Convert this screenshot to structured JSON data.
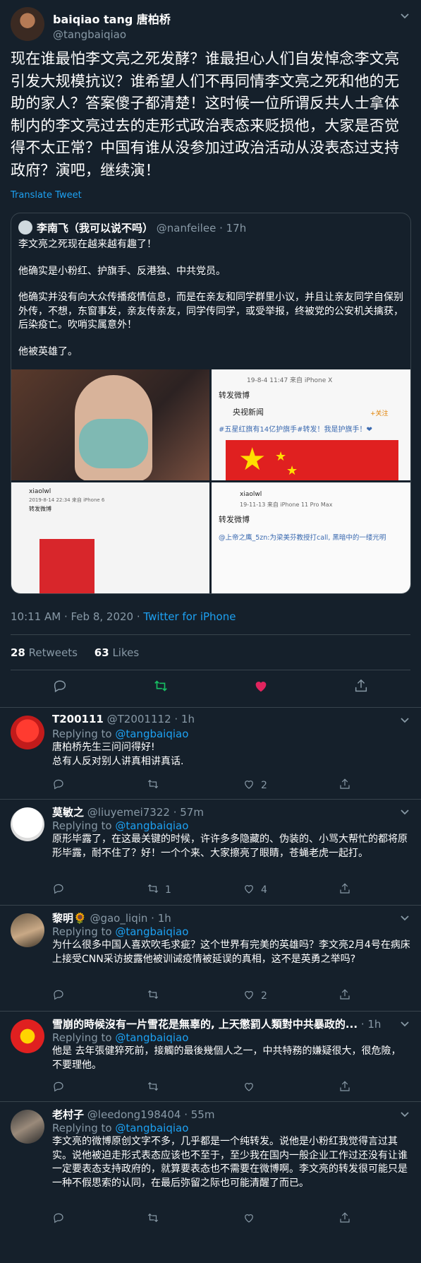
{
  "main_tweet": {
    "display_name": "baiqiao tang 唐柏桥",
    "handle": "@tangbaiqiao",
    "text": "现在谁最怕李文亮之死发酵？谁最担心人们自发悼念李文亮引发大规模抗议？谁希望人们不再同情李文亮之死和他的无助的家人？答案傻子都清楚！这时候一位所谓反共人士拿体制内的李文亮过去的走形式政治表态来贬损他，大家是否觉得不太正常？中国有谁从没参加过政治活动从没表态过支持政府？演吧，继续演！",
    "translate_label": "Translate Tweet",
    "timestamp": "10:11 AM · Feb 8, 2020 · ",
    "source": "Twitter for iPhone",
    "retweets_count": "28",
    "retweets_label": "Retweets",
    "likes_count": "63",
    "likes_label": "Likes"
  },
  "quoted_tweet": {
    "display_name": "李南飞（我可以说不吗）",
    "handle": "@nanfeilee",
    "time": "· 17h",
    "paragraphs": [
      "李文亮之死现在越来越有趣了！",
      "他确实是小粉红、护旗手、反港独、中共党员。",
      "他确实并没有向大众传播疫情信息，而是在亲友和同学群里小议，并且让亲友同学自保别外传，不想，东窗事发，亲友传亲友，同学传同学，或受举报，终被党的公安机关擒获，后染疫亡。吹哨实属意外！",
      "他被英雄了。"
    ],
    "media": {
      "t2_time": "19-8-4 11:47  来自 iPhone X",
      "t2_repost": "转发微博",
      "t2_source": "央视新闻",
      "t2_follow": "+关注",
      "t2_hashtag": "#五星红旗有14亿护旗手#转发！我是护旗手！❤",
      "t3_user": "xiaolwl",
      "t3_time": "2019-8-14 22:34 来自 iPhone 6",
      "t3_repost": "转发微博",
      "t4_user": "xiaolwl",
      "t4_time": "19-11-13  来自 iPhone 11 Pro Max",
      "t4_repost": "转发微博",
      "t4_mention": "@上帝之鹰_5zn:为梁美芬教授打call, 黑暗中的一缕光明"
    }
  },
  "replies": [
    {
      "display_name": "T200111",
      "handle": "@T2001112",
      "time": "· 1h",
      "replying_label": "Replying to",
      "replying_to": "@tangbaiqiao",
      "lines": [
        "唐柏桥先生三问问得好!",
        "总有人反对别人讲真相讲真话."
      ],
      "retweets": "",
      "likes": "2"
    },
    {
      "display_name": "莫敏之",
      "handle": "@liuyemei7322",
      "time": "· 57m",
      "replying_label": "Replying to",
      "replying_to": "@tangbaiqiao",
      "lines": [
        "原形毕露了，在这最关键的时候，许许多多隐藏的、伪装的、小骂大帮忙的都将原形毕露，耐不住了？好！一个个来、大家擦亮了眼睛，苍蝇老虎一起打。"
      ],
      "retweets": "1",
      "likes": "4"
    },
    {
      "display_name": "黎明🌻",
      "handle": "@gao_liqin",
      "time": "· 1h",
      "replying_label": "Replying to",
      "replying_to": "@tangbaiqiao",
      "lines": [
        "为什么很多中国人喜欢吹毛求疵？这个世界有完美的英雄吗？李文亮2月4号在病床上接受CNN采访披露他被训诫疫情被延误的真相，这不是英勇之举吗?"
      ],
      "retweets": "",
      "likes": "2"
    },
    {
      "display_name": "雪崩的時候沒有一片雪花是無辜的, 上天懲罰人類對中共暴政的...",
      "handle": "",
      "time": "· 1h",
      "replying_label": "Replying to",
      "replying_to": "@tangbaiqiao",
      "lines": [
        "他是 去年張健猝死前，接觸的最後幾個人之一，中共特務的嫌疑很大，很危險，不要理他。"
      ],
      "retweets": "",
      "likes": ""
    },
    {
      "display_name": "老村子",
      "handle": "@leedong198404",
      "time": "· 55m",
      "replying_label": "Replying to",
      "replying_to": "@tangbaiqiao",
      "lines": [
        "李文亮的微博原创文字不多，几乎都是一个纯转发。说他是小粉红我觉得言过其实。说他被迫走形式表态应该也不至于，至少我在国内一般企业工作过还没有让谁一定要表态支持政府的，就算要表态也不需要在微博啊。李文亮的转发很可能只是一种不假思索的认同，在最后弥留之际也可能清醒了而已。"
      ],
      "retweets": "",
      "likes": ""
    }
  ],
  "colors": {
    "background": "#15202b",
    "accent": "#1da1f2",
    "muted": "#8899a6",
    "retweet_active": "#17bf63",
    "like_active": "#e0245e",
    "border": "#38444d"
  },
  "icons": [
    "chevron-down-icon",
    "reply-icon",
    "retweet-icon",
    "like-icon",
    "share-icon"
  ]
}
